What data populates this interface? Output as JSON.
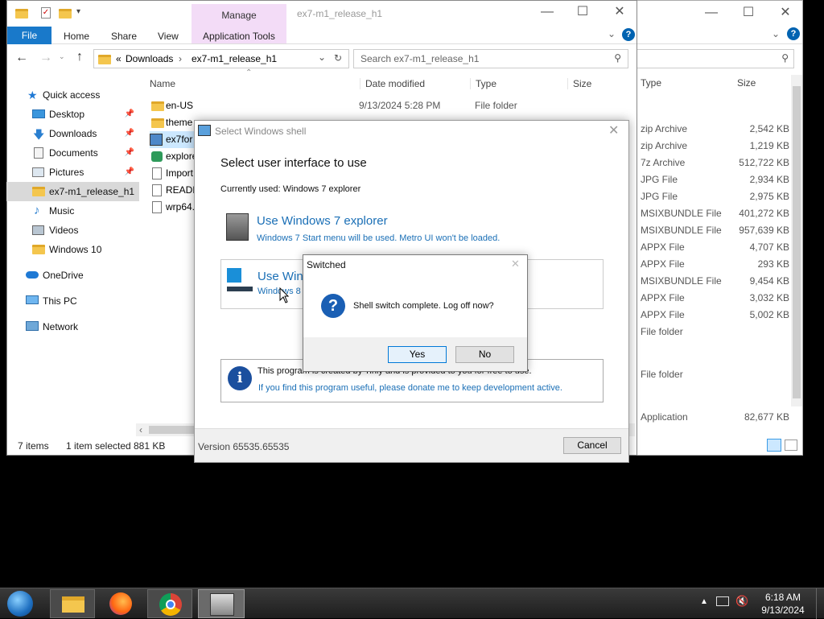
{
  "bg_window": {
    "columns": {
      "type": "Type",
      "size": "Size"
    },
    "rows": [
      {
        "type": "zip Archive",
        "size": "2,542 KB"
      },
      {
        "type": "zip Archive",
        "size": "1,219 KB"
      },
      {
        "type": "7z Archive",
        "size": "512,722 KB"
      },
      {
        "type": "JPG File",
        "size": "2,934 KB"
      },
      {
        "type": "JPG File",
        "size": "2,975 KB"
      },
      {
        "type": "MSIXBUNDLE File",
        "size": "401,272 KB"
      },
      {
        "type": "MSIXBUNDLE File",
        "size": "957,639 KB"
      },
      {
        "type": "APPX File",
        "size": "4,707 KB"
      },
      {
        "type": "APPX File",
        "size": "293 KB"
      },
      {
        "type": "MSIXBUNDLE File",
        "size": "9,454 KB"
      },
      {
        "type": "APPX File",
        "size": "3,032 KB"
      },
      {
        "type": "APPX File",
        "size": "5,002 KB"
      },
      {
        "type": "File folder",
        "size": ""
      },
      {
        "type": "File folder",
        "size": ""
      },
      {
        "type": "Application",
        "size": "82,677 KB"
      }
    ]
  },
  "explorer": {
    "title": "ex7-m1_release_h1",
    "manage_label": "Manage",
    "tabs": [
      "File",
      "Home",
      "Share",
      "View",
      "Application Tools"
    ],
    "breadcrumb": {
      "prefix": "«",
      "parts": [
        "Downloads",
        "ex7-m1_release_h1"
      ]
    },
    "search_placeholder": "Search ex7-m1_release_h1",
    "columns": {
      "name": "Name",
      "date": "Date modified",
      "type": "Type",
      "size": "Size"
    },
    "first_row": {
      "name": "en-US",
      "date": "9/13/2024 5:28 PM",
      "type": "File folder"
    },
    "partial_names": [
      "theme",
      "ex7for",
      "explore",
      "Import",
      "READM",
      "wrp64."
    ],
    "sidebar": {
      "quick_access": "Quick access",
      "items": [
        "Desktop",
        "Downloads",
        "Documents",
        "Pictures",
        "ex7-m1_release_h1",
        "Music",
        "Videos",
        "Windows 10"
      ],
      "onedrive": "OneDrive",
      "thispc": "This PC",
      "network": "Network"
    },
    "status": {
      "items": "7 items",
      "selected": "1 item selected",
      "size": "881 KB"
    }
  },
  "shell_dialog": {
    "title": "Select Windows shell",
    "heading": "Select user interface to use",
    "current": "Currently used: Windows 7 explorer",
    "opt1_title": "Use Windows 7 explorer",
    "opt1_desc": "Windows 7 Start menu will be used. Metro UI won't be loaded.",
    "opt2_title": "Use Win",
    "opt2_desc": "Windows 8",
    "info_text": "This program is created by Tihiy and is provided to you for free to use.",
    "donate_link": "If you find this program useful, please donate me to keep development active.",
    "version": "Version 65535.65535",
    "cancel": "Cancel"
  },
  "msgbox": {
    "title": "Switched",
    "message": "Shell switch complete. Log off now?",
    "yes": "Yes",
    "no": "No"
  },
  "taskbar": {
    "time": "6:18 AM",
    "date": "9/13/2024"
  },
  "colors": {
    "accent": "#0078d7",
    "manage": "#f3dcf7",
    "link": "#1a6fb6",
    "selected": "#cce8ff"
  }
}
